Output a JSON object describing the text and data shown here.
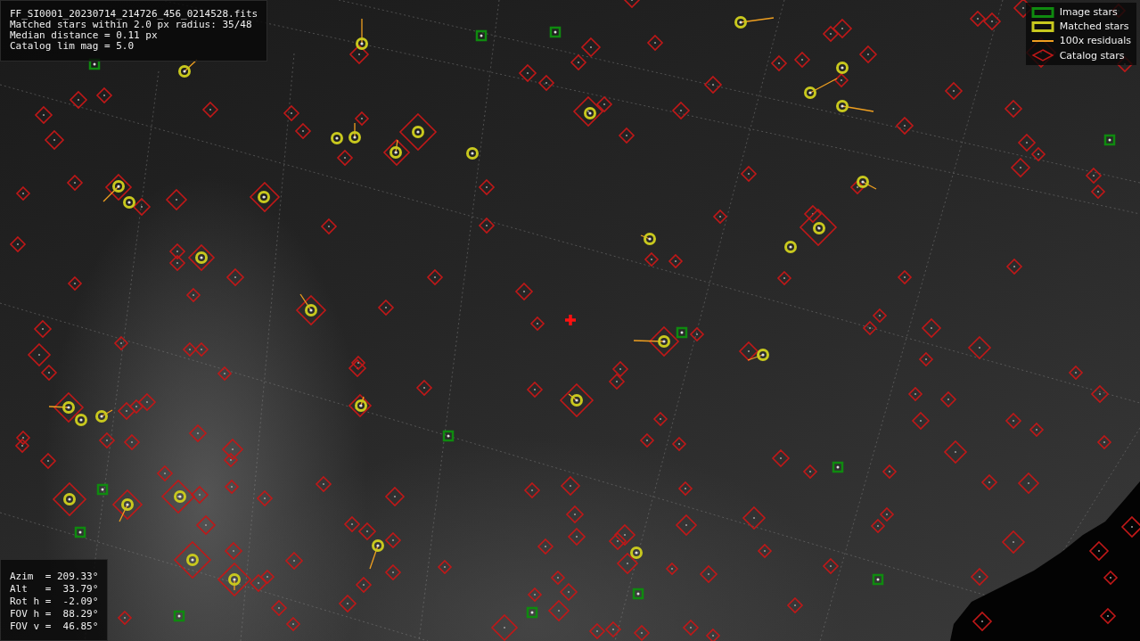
{
  "info_panel": {
    "lines": [
      "FF_SI0001_20230714_214726_456_0214528.fits",
      "Matched stars within 2.0 px radius: 35/48",
      "Median distance = 0.11 px",
      "Catalog lim mag = 5.0"
    ]
  },
  "legend": [
    {
      "kind": "image",
      "label": "Image stars",
      "color": "#0f8a0f"
    },
    {
      "kind": "matched",
      "label": "Matched stars",
      "color": "#c8c81e"
    },
    {
      "kind": "residual",
      "label": "100x residuals",
      "color": "#f0a020"
    },
    {
      "kind": "catalog",
      "label": "Catalog stars",
      "color": "#c01818"
    }
  ],
  "pointing_panel": {
    "lines": [
      "Azim  = 209.33°",
      "Alt   =  33.79°",
      "Rot h =  -2.09°",
      "FOV h =  88.29°",
      "FOV v =  46.85°"
    ]
  }
}
